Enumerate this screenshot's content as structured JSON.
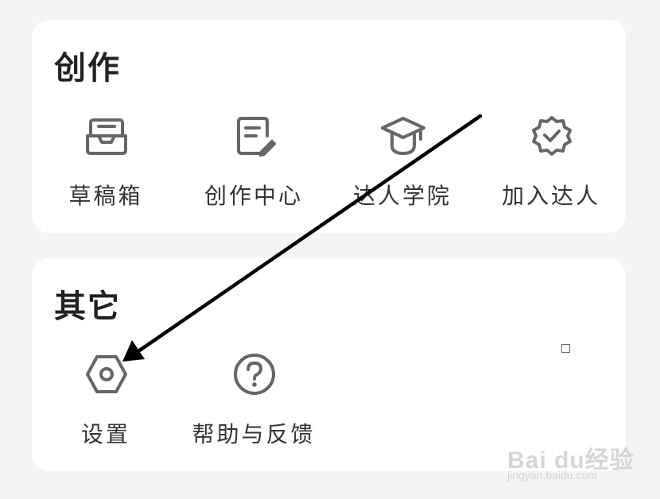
{
  "sections": {
    "create": {
      "title": "创作",
      "items": [
        {
          "label": "草稿箱",
          "icon": "inbox-tray-icon"
        },
        {
          "label": "创作中心",
          "icon": "document-edit-icon"
        },
        {
          "label": "达人学院",
          "icon": "graduation-cap-icon"
        },
        {
          "label": "加入达人",
          "icon": "verified-badge-icon"
        }
      ]
    },
    "other": {
      "title": "其它",
      "items": [
        {
          "label": "设置",
          "icon": "settings-hexagon-icon"
        },
        {
          "label": "帮助与反馈",
          "icon": "help-question-icon"
        }
      ]
    }
  },
  "watermark": {
    "brand": "Bai du经验",
    "url": "jingyan.baidu.com"
  },
  "colors": {
    "background": "#f4f4f6",
    "card": "#ffffff",
    "icon": "#666666",
    "text": "#333333",
    "arrow": "#000000"
  }
}
